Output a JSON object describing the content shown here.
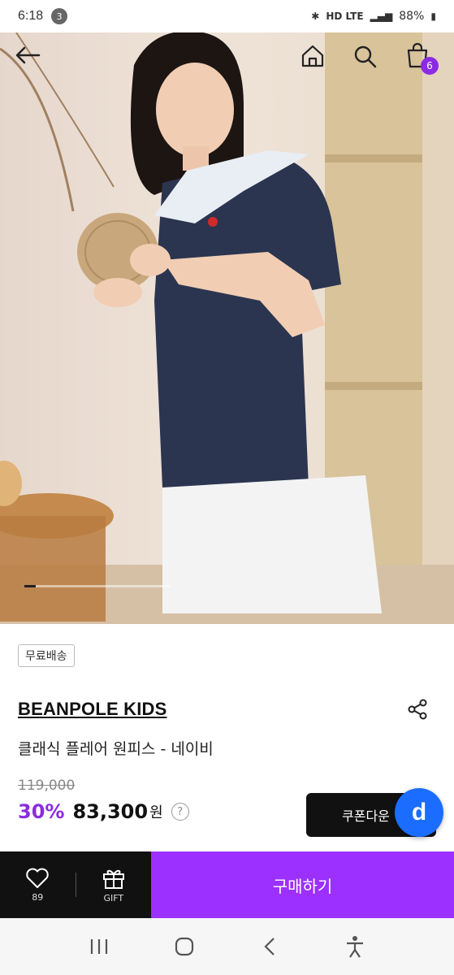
{
  "status_bar": {
    "time": "6:18",
    "notification_count": "3",
    "network": "HD LTE",
    "battery": "88%"
  },
  "hero": {
    "page_progress": 0.08
  },
  "header": {
    "cart_count": "6"
  },
  "product": {
    "shipping_tag": "무료배송",
    "brand": "BEANPOLE KIDS",
    "title": "클래식 플레어 원피스 - 네이비",
    "original_price": "119,000",
    "discount": "30%",
    "price": "83,300",
    "currency": "원",
    "help": "?"
  },
  "coupon_button": {
    "label": "쿠폰다운"
  },
  "chat_fab": {
    "label": "d"
  },
  "action_bar": {
    "like_count": "89",
    "gift_label": "GIFT",
    "buy_label": "구매하기"
  },
  "colors": {
    "accent": "#9b30ff",
    "discount": "#8a2be2",
    "chat": "#1a6dff",
    "dark": "#111111"
  }
}
